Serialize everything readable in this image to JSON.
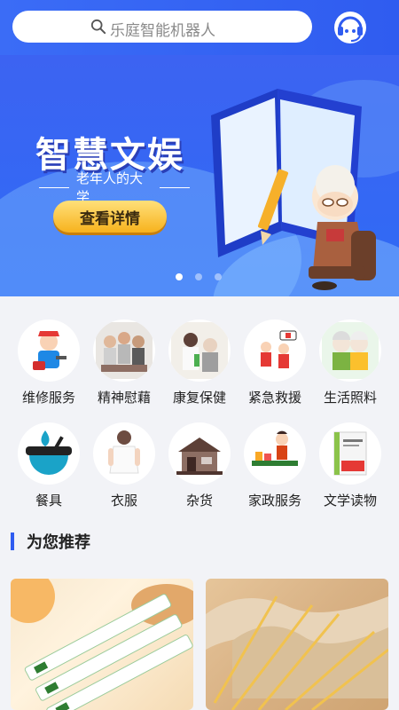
{
  "search": {
    "placeholder": "乐庭智能机器人",
    "icon": "search-icon"
  },
  "header": {
    "support_icon": "customer-service-icon",
    "accent": "#2f5cf0"
  },
  "banner": {
    "title": "智慧文娱",
    "subtitle": "老年人的大学",
    "button_label": "查看详情",
    "slides": 3,
    "active_slide": 1
  },
  "categories": [
    {
      "label": "维修服务",
      "icon": "repair-worker-icon"
    },
    {
      "label": "精神慰藉",
      "icon": "family-gathering-icon"
    },
    {
      "label": "康复保健",
      "icon": "health-care-icon"
    },
    {
      "label": "紧急救援",
      "icon": "emergency-rescue-icon"
    },
    {
      "label": "生活照料",
      "icon": "elderly-couple-icon"
    },
    {
      "label": "餐具",
      "icon": "tableware-bowl-icon"
    },
    {
      "label": "衣服",
      "icon": "clothing-icon"
    },
    {
      "label": "杂货",
      "icon": "groceries-store-icon"
    },
    {
      "label": "家政服务",
      "icon": "housekeeping-icon"
    },
    {
      "label": "文学读物",
      "icon": "book-icon"
    }
  ],
  "recommend": {
    "title": "为您推荐"
  }
}
